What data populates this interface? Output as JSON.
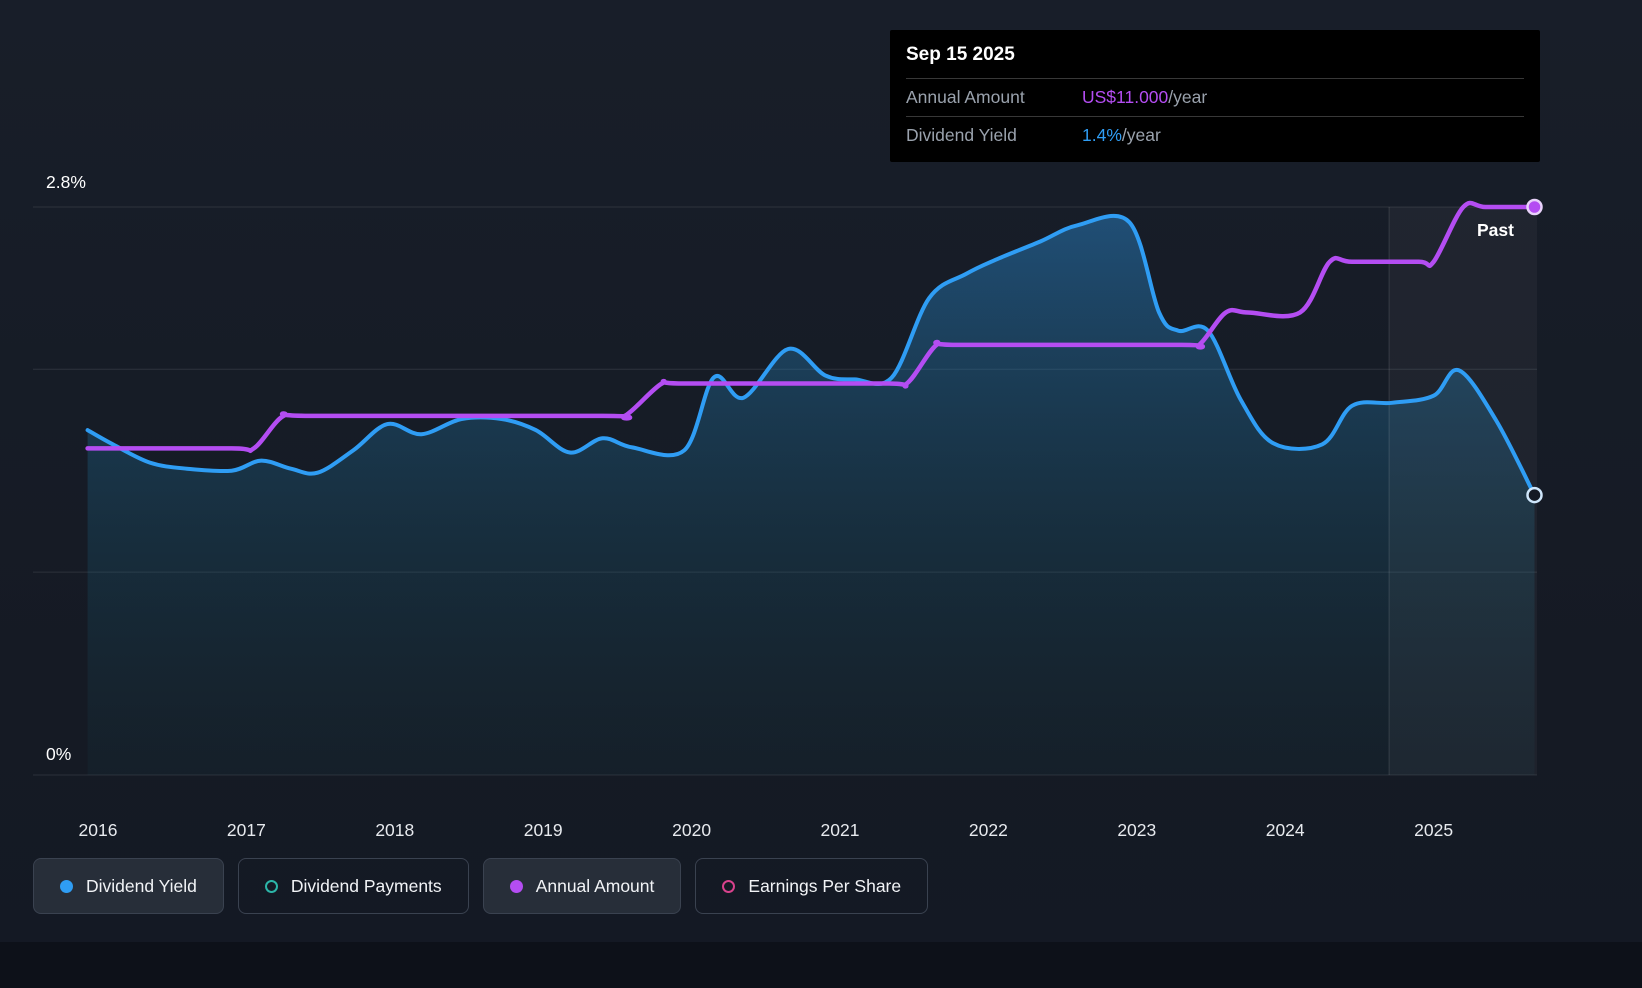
{
  "tooltip": {
    "date": "Sep 15 2025",
    "rows": [
      {
        "label": "Annual Amount",
        "value": "US$11.000",
        "suffix": "/year",
        "color": "#b44df2"
      },
      {
        "label": "Dividend Yield",
        "value": "1.4%",
        "suffix": "/year",
        "color": "#2f9df4"
      }
    ]
  },
  "past_label": "Past",
  "legend": [
    {
      "label": "Dividend Yield",
      "marker": "filled",
      "color": "#2f9df4",
      "active": true
    },
    {
      "label": "Dividend Payments",
      "marker": "open",
      "color": "#2cb5a8",
      "active": false
    },
    {
      "label": "Annual Amount",
      "marker": "filled",
      "color": "#b44df2",
      "active": true
    },
    {
      "label": "Earnings Per Share",
      "marker": "open",
      "color": "#d8428c",
      "active": false
    }
  ],
  "chart_data": {
    "type": "line",
    "xlim": [
      2015.93,
      2025.68
    ],
    "ylim": [
      0,
      2.8
    ],
    "ylabel_top": "2.8%",
    "ylabel_bottom": "0%",
    "x_ticks": [
      2016,
      2017,
      2018,
      2019,
      2020,
      2021,
      2022,
      2023,
      2024,
      2025
    ],
    "grid_percents": [
      0,
      1,
      2,
      2.8
    ],
    "grid_color": "rgba(255,255,255,0.10)",
    "past_region_start": 2024.7,
    "past_fill": "rgba(255,255,255,0.04)",
    "past_edge": "rgba(255,255,255,0.12)",
    "legend_position": "bottom",
    "area_gradient": [
      [
        "0%",
        "#2e9bf0",
        0.4
      ],
      [
        "55%",
        "#1e7fa8",
        0.2
      ],
      [
        "100%",
        "#1a5e66",
        0.08
      ]
    ],
    "series": [
      {
        "name": "Dividend Yield",
        "unit": "%",
        "color": "#2f9df4",
        "width": 4,
        "fill": true,
        "end_marker": {
          "stroke": "#cfe6fb",
          "fill": "#141924"
        },
        "points": [
          [
            2015.93,
            1.7
          ],
          [
            2016.1,
            1.63
          ],
          [
            2016.35,
            1.54
          ],
          [
            2016.6,
            1.51
          ],
          [
            2016.9,
            1.5
          ],
          [
            2017.1,
            1.55
          ],
          [
            2017.3,
            1.51
          ],
          [
            2017.48,
            1.49
          ],
          [
            2017.72,
            1.6
          ],
          [
            2017.95,
            1.73
          ],
          [
            2018.18,
            1.68
          ],
          [
            2018.45,
            1.755
          ],
          [
            2018.72,
            1.755
          ],
          [
            2018.95,
            1.7
          ],
          [
            2019.18,
            1.59
          ],
          [
            2019.4,
            1.66
          ],
          [
            2019.6,
            1.615
          ],
          [
            2019.95,
            1.6
          ],
          [
            2020.15,
            1.96
          ],
          [
            2020.35,
            1.86
          ],
          [
            2020.65,
            2.1
          ],
          [
            2020.9,
            1.97
          ],
          [
            2021.1,
            1.95
          ],
          [
            2021.35,
            1.96
          ],
          [
            2021.6,
            2.35
          ],
          [
            2021.85,
            2.47
          ],
          [
            2022.05,
            2.54
          ],
          [
            2022.35,
            2.63
          ],
          [
            2022.6,
            2.71
          ],
          [
            2022.95,
            2.725
          ],
          [
            2023.15,
            2.28
          ],
          [
            2023.28,
            2.19
          ],
          [
            2023.48,
            2.19
          ],
          [
            2023.7,
            1.85
          ],
          [
            2023.92,
            1.635
          ],
          [
            2024.25,
            1.63
          ],
          [
            2024.45,
            1.82
          ],
          [
            2024.72,
            1.835
          ],
          [
            2025.0,
            1.87
          ],
          [
            2025.17,
            1.995
          ],
          [
            2025.42,
            1.75
          ],
          [
            2025.68,
            1.38
          ]
        ]
      },
      {
        "name": "Annual Amount",
        "unit": "US$/year (scaled)",
        "color": "#b44df2",
        "width": 4.5,
        "fill": false,
        "end_marker": {
          "stroke": "#e8d2fa",
          "fill": "#b44df2"
        },
        "points": [
          [
            2015.93,
            1.61
          ],
          [
            2016.9,
            1.61
          ],
          [
            2017.05,
            1.61
          ],
          [
            2017.25,
            1.77
          ],
          [
            2017.45,
            1.77
          ],
          [
            2019.4,
            1.77
          ],
          [
            2019.55,
            1.77
          ],
          [
            2019.8,
            1.93
          ],
          [
            2019.95,
            1.93
          ],
          [
            2021.3,
            1.93
          ],
          [
            2021.45,
            1.93
          ],
          [
            2021.65,
            2.12
          ],
          [
            2021.8,
            2.12
          ],
          [
            2023.3,
            2.12
          ],
          [
            2023.42,
            2.12
          ],
          [
            2023.6,
            2.28
          ],
          [
            2023.75,
            2.28
          ],
          [
            2024.1,
            2.28
          ],
          [
            2024.3,
            2.53
          ],
          [
            2024.45,
            2.53
          ],
          [
            2024.9,
            2.53
          ],
          [
            2025.0,
            2.53
          ],
          [
            2025.2,
            2.8
          ],
          [
            2025.35,
            2.8
          ],
          [
            2025.68,
            2.8
          ]
        ]
      }
    ]
  }
}
